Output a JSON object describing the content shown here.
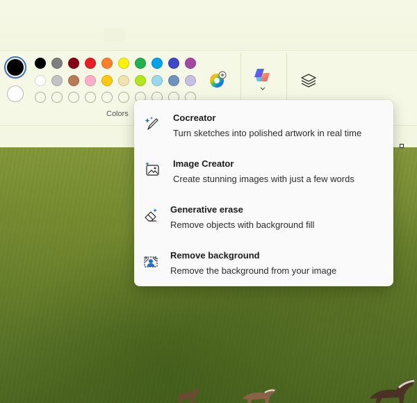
{
  "colors": {
    "primary": "#000000",
    "secondary": "#ffffff",
    "label": "Colors",
    "palette_row1": [
      "#000000",
      "#7f7f7f",
      "#880015",
      "#ed1c24",
      "#ff7f27",
      "#fff200",
      "#22b14c",
      "#00a2e8",
      "#3f48cc",
      "#a349a4"
    ],
    "palette_row2": [
      "#ffffff",
      "#c3c3c3",
      "#b97a57",
      "#ffaec9",
      "#ffc90e",
      "#efe4b0",
      "#b5e61d",
      "#99d9ea",
      "#7092be",
      "#c8bfe7"
    ],
    "custom_slots": 10,
    "edit_colors_icon": "color-wheel-plus-icon"
  },
  "toolbar": {
    "copilot_icon": "copilot-icon",
    "copilot_chevron_icon": "chevron-down-icon",
    "layers_icon": "layers-icon"
  },
  "menu": {
    "items": [
      {
        "icon": "pen-sparkle-icon",
        "title": "Cocreator",
        "desc": "Turn sketches into polished artwork in real time"
      },
      {
        "icon": "image-sparkle-icon",
        "title": "Image Creator",
        "desc": "Create stunning images with just a few words"
      },
      {
        "icon": "eraser-sparkle-icon",
        "title": "Generative erase",
        "desc": "Remove objects with background fill"
      },
      {
        "icon": "remove-background-icon",
        "title": "Remove background",
        "desc": "Remove the background from your image"
      }
    ]
  }
}
